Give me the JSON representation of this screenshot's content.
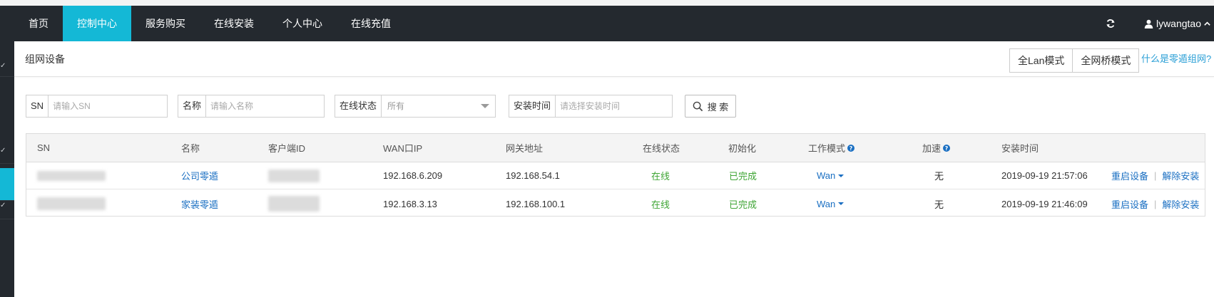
{
  "nav": {
    "items": [
      {
        "label": "首页",
        "active": false
      },
      {
        "label": "控制中心",
        "active": true
      },
      {
        "label": "服务购买",
        "active": false
      },
      {
        "label": "在线安装",
        "active": false
      },
      {
        "label": "个人中心",
        "active": false
      },
      {
        "label": "在线充值",
        "active": false
      }
    ],
    "username": "lywangtao",
    "refresh_icon": "refresh-icon",
    "user_icon": "user-icon"
  },
  "subheader": {
    "title": "组网设备",
    "mode_buttons": [
      "全Lan模式",
      "全网桥模式"
    ],
    "help_link": "什么是零遁组网?"
  },
  "filters": {
    "sn": {
      "label": "SN",
      "placeholder": "请输入SN"
    },
    "name": {
      "label": "名称",
      "placeholder": "请输入名称"
    },
    "status": {
      "label": "在线状态",
      "value": "所有"
    },
    "install_time": {
      "label": "安装时间",
      "placeholder": "请选择安装时间"
    },
    "search_label": "搜 索"
  },
  "table": {
    "columns": {
      "sn": "SN",
      "name": "名称",
      "client_id": "客户端ID",
      "wan_ip": "WAN口IP",
      "gateway": "网关地址",
      "online": "在线状态",
      "init": "初始化",
      "work_mode": "工作模式",
      "accel": "加速",
      "install_time": "安装时间"
    },
    "rows": [
      {
        "name": "公司零遁",
        "wan_ip": "192.168.6.209",
        "gateway": "192.168.54.1",
        "online": "在线",
        "init": "已完成",
        "work_mode": "Wan",
        "accel": "无",
        "install_time": "2019-09-19 21:57:06",
        "action_restart": "重启设备",
        "action_uninstall": "解除安装"
      },
      {
        "name": "家装零遁",
        "wan_ip": "192.168.3.13",
        "gateway": "192.168.100.1",
        "online": "在线",
        "init": "已完成",
        "work_mode": "Wan",
        "accel": "无",
        "install_time": "2019-09-19 21:46:09",
        "action_restart": "重启设备",
        "action_uninstall": "解除安装"
      }
    ]
  },
  "colors": {
    "navbar_bg": "#24292f",
    "accent": "#14b8d6",
    "link": "#1a6fc2",
    "status_green": "#3fa535"
  }
}
